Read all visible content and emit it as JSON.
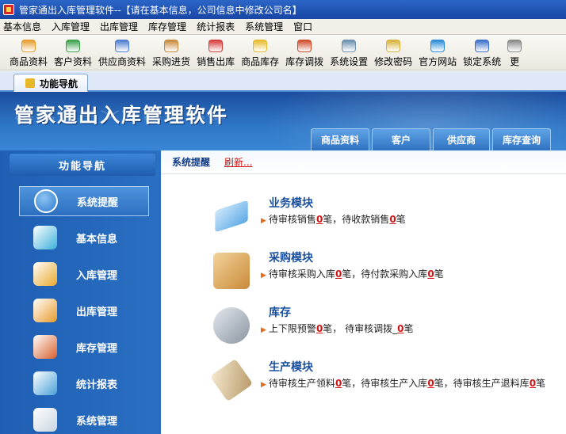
{
  "window": {
    "title": "管家通出入库管理软件--【请在基本信息，公司信息中修改公司名】"
  },
  "menu": [
    "基本信息",
    "入库管理",
    "出库管理",
    "库存管理",
    "统计报表",
    "系统管理",
    "窗口"
  ],
  "toolbar": [
    {
      "label": "商品资料",
      "icon": "goods-icon",
      "color": "#e59a2b"
    },
    {
      "label": "客户资料",
      "icon": "customer-icon",
      "color": "#3aa04a"
    },
    {
      "label": "供应商资料",
      "icon": "supplier-icon",
      "color": "#4a7bd0"
    },
    {
      "label": "采购进货",
      "icon": "purchase-icon",
      "color": "#c98a3a"
    },
    {
      "label": "销售出库",
      "icon": "sales-icon",
      "color": "#d63a3a"
    },
    {
      "label": "商品库存",
      "icon": "stock-icon",
      "color": "#e8b92a"
    },
    {
      "label": "库存调拨",
      "icon": "transfer-icon",
      "color": "#d04a2a"
    },
    {
      "label": "系统设置",
      "icon": "settings-icon",
      "color": "#6a8fb0"
    },
    {
      "label": "修改密码",
      "icon": "password-icon",
      "color": "#d8b23a"
    },
    {
      "label": "官方网站",
      "icon": "website-icon",
      "color": "#2a8ad8"
    },
    {
      "label": "锁定系统",
      "icon": "lock-icon",
      "color": "#3a6ec8"
    },
    {
      "label": "更",
      "icon": "more-icon",
      "color": "#888888"
    }
  ],
  "tab": {
    "label": "功能导航"
  },
  "banner": {
    "title": "管家通出入库管理软件",
    "tabs": [
      "商品资料",
      "客户",
      "供应商",
      "库存查询"
    ]
  },
  "sidebar": {
    "header": "功能导航",
    "items": [
      {
        "label": "系统提醒",
        "icon": "info-icon",
        "color": "#2f7ad0",
        "active": true
      },
      {
        "label": "基本信息",
        "icon": "cubes-icon",
        "color": "#3ab0d8"
      },
      {
        "label": "入库管理",
        "icon": "box-in-icon",
        "color": "#e8a82a"
      },
      {
        "label": "出库管理",
        "icon": "box-out-icon",
        "color": "#e89a2a"
      },
      {
        "label": "库存管理",
        "icon": "warehouse-icon",
        "color": "#d8602a"
      },
      {
        "label": "统计报表",
        "icon": "chart-icon",
        "color": "#4aa0d8"
      },
      {
        "label": "系统管理",
        "icon": "gears-icon",
        "color": "#c8d4e0"
      }
    ]
  },
  "main": {
    "tabs": {
      "active": "系统提醒",
      "refresh": "刷新..."
    },
    "modules": [
      {
        "title": "业务模块",
        "icon": "folder-icon",
        "parts": [
          "待审核销售",
          "0",
          "笔，待收款销售",
          "0",
          "笔"
        ]
      },
      {
        "title": "采购模块",
        "icon": "package-icon",
        "parts": [
          "待审核采购入库",
          "0",
          "笔，待付款采购入库",
          "0",
          "笔"
        ]
      },
      {
        "title": "库存",
        "icon": "database-icon",
        "parts": [
          "上下限预警",
          "0",
          "笔，  待审核调拨_",
          "0",
          "笔"
        ]
      },
      {
        "title": "生产模块",
        "icon": "clipboard-icon",
        "parts": [
          "待审核生产领料",
          "0",
          "笔，待审核生产入库",
          "0",
          "笔，待审核生产退料库",
          "0",
          "笔"
        ]
      }
    ]
  }
}
